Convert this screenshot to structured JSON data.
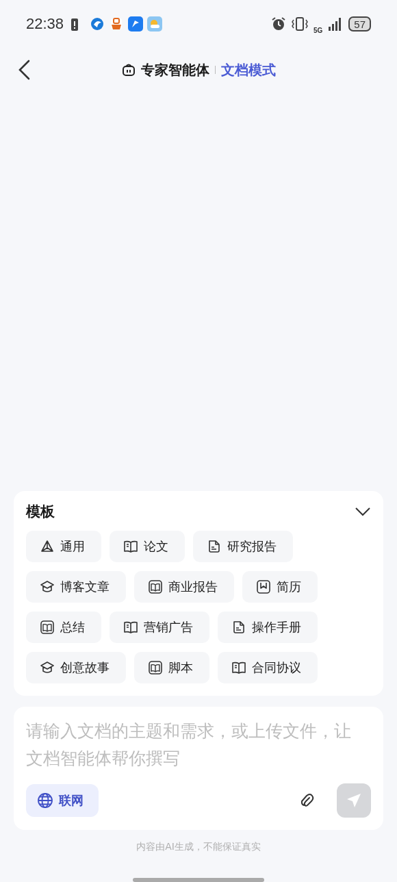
{
  "status_bar": {
    "time": "22:38",
    "battery": "57",
    "network": "5G"
  },
  "header": {
    "agent": "专家智能体",
    "mode": "文档模式"
  },
  "templates": {
    "title": "模板",
    "rows": [
      {
        "items": [
          {
            "label": "通用",
            "kind": "triangle"
          },
          {
            "label": "论文",
            "kind": "book"
          },
          {
            "label": "研究报告",
            "kind": "page"
          }
        ]
      },
      {
        "items": [
          {
            "label": "博客文章",
            "kind": "cap"
          },
          {
            "label": "商业报告",
            "kind": "framed"
          },
          {
            "label": "简历",
            "kind": "bookmark"
          }
        ]
      },
      {
        "items": [
          {
            "label": "总结",
            "kind": "framed"
          },
          {
            "label": "营销广告",
            "kind": "book"
          },
          {
            "label": "操作手册",
            "kind": "page"
          }
        ]
      },
      {
        "items": [
          {
            "label": "创意故事",
            "kind": "cap"
          },
          {
            "label": "脚本",
            "kind": "framed"
          },
          {
            "label": "合同协议",
            "kind": "book"
          }
        ]
      }
    ]
  },
  "composer": {
    "placeholder": "请输入文档的主题和需求，或上传文件，让文档智能体帮你撰写",
    "web_search": {
      "label": "联网",
      "selected": true
    }
  },
  "disclaimer": "内容由AI生成，不能保证真实"
}
